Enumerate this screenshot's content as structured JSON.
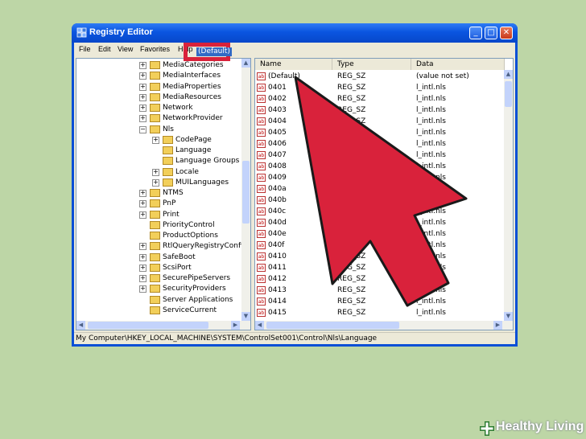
{
  "window": {
    "title": "Registry Editor",
    "min": "_",
    "max": "□",
    "close": "✕"
  },
  "menu": [
    "File",
    "Edit",
    "View",
    "Favorites",
    "Help"
  ],
  "tree": [
    {
      "label": "MediaCategories",
      "expander": "+"
    },
    {
      "label": "MediaInterfaces",
      "expander": "+"
    },
    {
      "label": "MediaProperties",
      "expander": "+"
    },
    {
      "label": "MediaResources",
      "expander": "+"
    },
    {
      "label": "Network",
      "expander": "+"
    },
    {
      "label": "NetworkProvider",
      "expander": "+"
    },
    {
      "label": "Nls",
      "expander": "−"
    },
    {
      "label": "CodePage",
      "expander": "+",
      "child": true
    },
    {
      "label": "Language",
      "expander": "",
      "child": true
    },
    {
      "label": "Language Groups",
      "expander": "",
      "child": true
    },
    {
      "label": "Locale",
      "expander": "+",
      "child": true
    },
    {
      "label": "MUILanguages",
      "expander": "+",
      "child": true
    },
    {
      "label": "NTMS",
      "expander": "+"
    },
    {
      "label": "PnP",
      "expander": "+"
    },
    {
      "label": "Print",
      "expander": "+"
    },
    {
      "label": "PriorityControl",
      "expander": ""
    },
    {
      "label": "ProductOptions",
      "expander": ""
    },
    {
      "label": "RtlQueryRegistryConfig",
      "expander": "+"
    },
    {
      "label": "SafeBoot",
      "expander": "+"
    },
    {
      "label": "ScsiPort",
      "expander": "+"
    },
    {
      "label": "SecurePipeServers",
      "expander": "+"
    },
    {
      "label": "SecurityProviders",
      "expander": "+"
    },
    {
      "label": "Server Applications",
      "expander": ""
    },
    {
      "label": "ServiceCurrent",
      "expander": ""
    }
  ],
  "columns": {
    "name": "Name",
    "type": "Type",
    "data": "Data"
  },
  "rows": [
    {
      "name": "(Default)",
      "type": "REG_SZ",
      "data": "(value not set)"
    },
    {
      "name": "0401",
      "type": "REG_SZ",
      "data": "l_intl.nls"
    },
    {
      "name": "0402",
      "type": "REG_SZ",
      "data": "l_intl.nls"
    },
    {
      "name": "0403",
      "type": "REG_SZ",
      "data": "l_intl.nls"
    },
    {
      "name": "0404",
      "type": "REG_SZ",
      "data": "l_intl.nls"
    },
    {
      "name": "0405",
      "type": "REG_SZ",
      "data": "l_intl.nls"
    },
    {
      "name": "0406",
      "type": "REG_SZ",
      "data": "l_intl.nls"
    },
    {
      "name": "0407",
      "type": "REG_SZ",
      "data": "l_intl.nls"
    },
    {
      "name": "0408",
      "type": "REG_SZ",
      "data": "l_intl.nls"
    },
    {
      "name": "0409",
      "type": "REG_SZ",
      "data": "l_intl.nls"
    },
    {
      "name": "040a",
      "type": "REG_SZ",
      "data": "l_intl.nls"
    },
    {
      "name": "040b",
      "type": "REG_SZ",
      "data": "l_intl.nls"
    },
    {
      "name": "040c",
      "type": "REG_SZ",
      "data": "l_intl.nls"
    },
    {
      "name": "040d",
      "type": "REG_SZ",
      "data": "l_intl.nls"
    },
    {
      "name": "040e",
      "type": "REG_SZ",
      "data": "l_intl.nls"
    },
    {
      "name": "040f",
      "type": "REG_SZ",
      "data": "l_intl.nls"
    },
    {
      "name": "0410",
      "type": "REG_SZ",
      "data": "l_intl.nls"
    },
    {
      "name": "0411",
      "type": "REG_SZ",
      "data": "l_intl.nls"
    },
    {
      "name": "0412",
      "type": "REG_SZ",
      "data": "l_intl.nls"
    },
    {
      "name": "0413",
      "type": "REG_SZ",
      "data": "l_intl.nls"
    },
    {
      "name": "0414",
      "type": "REG_SZ",
      "data": "l_intl.nls"
    },
    {
      "name": "0415",
      "type": "REG_SZ",
      "data": "l_intl.nls"
    }
  ],
  "row_icon_text": "ab",
  "status": "My Computer\\HKEY_LOCAL_MACHINE\\SYSTEM\\ControlSet001\\Control\\Nls\\Language",
  "annotation": {
    "arrow_color": "#d9223b"
  },
  "watermark": "Healthy Living",
  "watermark_colors": {
    "text": "#ffffff",
    "cross": "#2e7d32"
  }
}
